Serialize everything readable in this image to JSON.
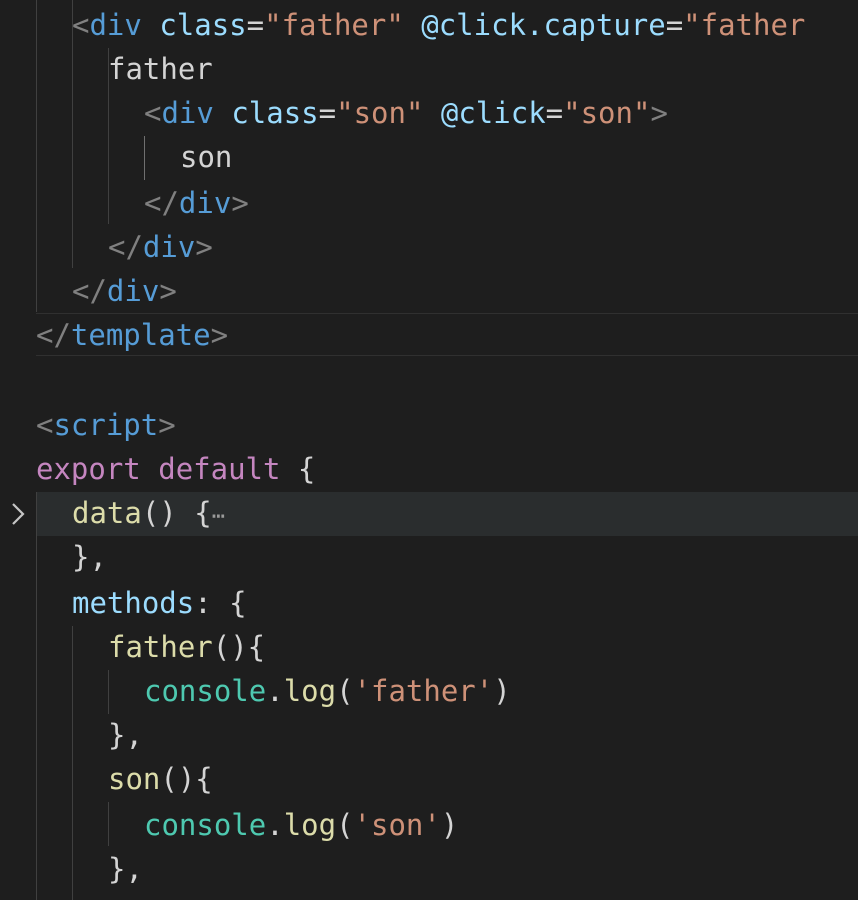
{
  "editor": {
    "folded_line_ellipsis": "⋯",
    "lines": [
      {
        "tokens": [
          [
            "<",
            "punc"
          ],
          [
            "div",
            "tag"
          ],
          [
            " ",
            "txt"
          ],
          [
            "class",
            "attr"
          ],
          [
            "=",
            "txt"
          ],
          [
            "\"father\"",
            "str"
          ],
          [
            " ",
            "txt"
          ],
          [
            "@click.capture",
            "attr"
          ],
          [
            "=",
            "txt"
          ],
          [
            "\"father",
            "str"
          ]
        ]
      },
      {
        "tokens": [
          [
            "father",
            "txt"
          ]
        ]
      },
      {
        "tokens": [
          [
            "<",
            "punc"
          ],
          [
            "div",
            "tag"
          ],
          [
            " ",
            "txt"
          ],
          [
            "class",
            "attr"
          ],
          [
            "=",
            "txt"
          ],
          [
            "\"son\"",
            "str"
          ],
          [
            " ",
            "txt"
          ],
          [
            "@click",
            "attr"
          ],
          [
            "=",
            "txt"
          ],
          [
            "\"son\"",
            "str"
          ],
          [
            ">",
            "punc"
          ]
        ]
      },
      {
        "tokens": [
          [
            "son",
            "txt"
          ]
        ]
      },
      {
        "tokens": [
          [
            "</",
            "punc"
          ],
          [
            "div",
            "tag"
          ],
          [
            ">",
            "punc"
          ]
        ]
      },
      {
        "tokens": [
          [
            "</",
            "punc"
          ],
          [
            "div",
            "tag"
          ],
          [
            ">",
            "punc"
          ]
        ]
      },
      {
        "tokens": [
          [
            "</",
            "punc"
          ],
          [
            "div",
            "tag"
          ],
          [
            ">",
            "punc"
          ]
        ]
      },
      {
        "tokens": [
          [
            "</",
            "punc"
          ],
          [
            "template",
            "tag"
          ],
          [
            ">",
            "punc"
          ]
        ]
      },
      {
        "tokens": []
      },
      {
        "tokens": [
          [
            "<",
            "punc"
          ],
          [
            "script",
            "tag"
          ],
          [
            ">",
            "punc"
          ]
        ]
      },
      {
        "tokens": [
          [
            "export",
            "kw"
          ],
          [
            " ",
            "txt"
          ],
          [
            "default",
            "kw"
          ],
          [
            " {",
            "txt"
          ]
        ]
      },
      {
        "tokens": [
          [
            "data",
            "fn"
          ],
          [
            "() {",
            "txt"
          ]
        ],
        "folded": true
      },
      {
        "tokens": [
          [
            "},",
            "txt"
          ]
        ]
      },
      {
        "tokens": [
          [
            "methods",
            "prop"
          ],
          [
            ": {",
            "txt"
          ]
        ]
      },
      {
        "tokens": [
          [
            "father",
            "fn"
          ],
          [
            "(){",
            "txt"
          ]
        ]
      },
      {
        "tokens": [
          [
            "console",
            "cls"
          ],
          [
            ".",
            "txt"
          ],
          [
            "log",
            "fn"
          ],
          [
            "(",
            "txt"
          ],
          [
            "'father'",
            "str"
          ],
          [
            ")",
            "txt"
          ]
        ]
      },
      {
        "tokens": [
          [
            "},",
            "txt"
          ]
        ]
      },
      {
        "tokens": [
          [
            "son",
            "fn"
          ],
          [
            "(){",
            "txt"
          ]
        ]
      },
      {
        "tokens": [
          [
            "console",
            "cls"
          ],
          [
            ".",
            "txt"
          ],
          [
            "log",
            "fn"
          ],
          [
            "(",
            "txt"
          ],
          [
            "'son'",
            "str"
          ],
          [
            ")",
            "txt"
          ]
        ]
      },
      {
        "tokens": [
          [
            "},",
            "txt"
          ]
        ]
      },
      {
        "tokens": [
          [
            "",
            "txt"
          ]
        ]
      }
    ]
  }
}
